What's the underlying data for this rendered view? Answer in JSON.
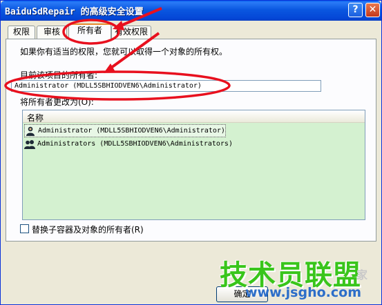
{
  "window": {
    "title": "BaiduSdRepair 的高级安全设置",
    "help_label": "?",
    "close_label": "✕"
  },
  "tabs": [
    {
      "label": "权限"
    },
    {
      "label": "审核"
    },
    {
      "label": "所有者",
      "active": true
    },
    {
      "label": "有效权限"
    }
  ],
  "owner_panel": {
    "description": "如果你有适当的权限，您就可以取得一个对象的所有权。",
    "current_owner_label": "目前该项目的所有者:",
    "current_owner_value": "Administrator (MDLL5SBHIODVEN6\\Administrator)",
    "change_owner_label": "将所有者更改为(O):",
    "list_header": "名称",
    "list_items": [
      {
        "name": "Administrator (MDLL5SBHIODVEN6\\Administrator)",
        "icon": "user-icon",
        "selected": true
      },
      {
        "name": "Administrators (MDLL5SBHIODVEN6\\Administrators)",
        "icon": "group-icon",
        "selected": false
      }
    ],
    "replace_checkbox_label": "替换子容器及对象的所有者(R)",
    "replace_checked": false
  },
  "footer": {
    "ok_label": "确定"
  },
  "watermark": {
    "text": "技术员联盟",
    "url": "www.jsgho.com",
    "suffix": "家"
  },
  "colors": {
    "annotation": "#e8101e",
    "list_background": "#d4f1d0",
    "title_bar": "#0a57e0"
  }
}
